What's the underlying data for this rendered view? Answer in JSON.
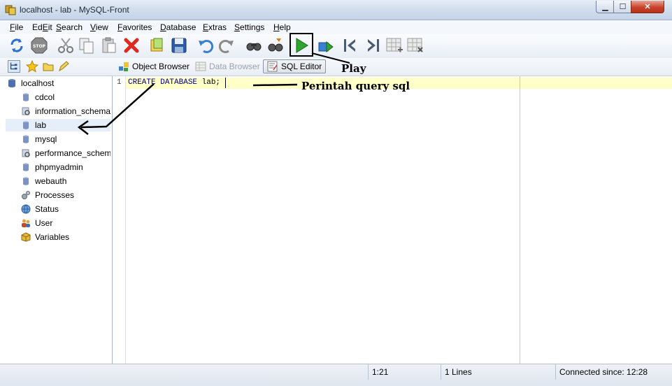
{
  "window": {
    "title": "localhost - lab - MySQL-Front",
    "minimize_glyph": "▁",
    "maximize_glyph": "☐",
    "close_glyph": "✕"
  },
  "menu": [
    {
      "key": "F",
      "rest": "ile"
    },
    {
      "key": "E",
      "pre": "Ed",
      "rest": "it"
    },
    {
      "key": "S",
      "rest": "earch"
    },
    {
      "key": "V",
      "rest": "iew"
    },
    {
      "key": "F",
      "pre": "",
      "rest": "avorites"
    },
    {
      "key": "D",
      "rest": "atabase"
    },
    {
      "key": "E",
      "rest": "xtras"
    },
    {
      "key": "S",
      "rest": "ettings"
    },
    {
      "key": "H",
      "rest": "elp"
    }
  ],
  "menu_labels": [
    "File",
    "Edit",
    "Search",
    "View",
    "Favorites",
    "Database",
    "Extras",
    "Settings",
    "Help"
  ],
  "toolbar_icons": [
    "refresh-icon",
    "stop-icon",
    "cut-icon",
    "copy-icon",
    "paste-icon",
    "delete-icon",
    "open-icon",
    "save-icon",
    "undo-icon",
    "redo-icon",
    "find-icon",
    "replace-icon",
    "play-icon",
    "run-selection-icon",
    "first-icon",
    "last-icon",
    "grid-add-icon",
    "grid-delete-icon"
  ],
  "views": {
    "object_browser": "Object Browser",
    "data_browser": "Data Browser",
    "sql_editor": "SQL Editor"
  },
  "tree": {
    "root": "localhost",
    "databases": [
      "cdcol",
      "information_schema",
      "lab",
      "mysql",
      "performance_schema",
      "phpmyadmin",
      "webauth"
    ],
    "selected": "lab",
    "system": [
      "Processes",
      "Status",
      "User",
      "Variables"
    ]
  },
  "editor": {
    "line_number": "1",
    "kw1": "CREATE",
    "kw2": "DATABASE",
    "rest": " lab;"
  },
  "annotations": {
    "play": "Play",
    "query": "Perintah query sql"
  },
  "status": {
    "position": "1:21",
    "lines": "1 Lines",
    "connected": "Connected since: 12:28"
  },
  "colors": {
    "accent": "#1e7b1e",
    "current_line": "#ffffc8",
    "titlebar": "#d3dfee"
  }
}
